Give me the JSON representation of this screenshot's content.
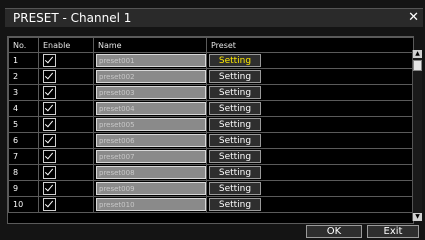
{
  "window": {
    "title": "PRESET - Channel 1",
    "close_glyph": "✕"
  },
  "table": {
    "headers": {
      "no": "No.",
      "enable": "Enable",
      "name": "Name",
      "preset": "Preset"
    },
    "rows": [
      {
        "no": "1",
        "enabled": true,
        "name": "preset001",
        "button": "Setting"
      },
      {
        "no": "2",
        "enabled": true,
        "name": "preset002",
        "button": "Setting"
      },
      {
        "no": "3",
        "enabled": true,
        "name": "preset003",
        "button": "Setting"
      },
      {
        "no": "4",
        "enabled": true,
        "name": "preset004",
        "button": "Setting"
      },
      {
        "no": "5",
        "enabled": true,
        "name": "preset005",
        "button": "Setting"
      },
      {
        "no": "6",
        "enabled": true,
        "name": "preset006",
        "button": "Setting"
      },
      {
        "no": "7",
        "enabled": true,
        "name": "preset007",
        "button": "Setting"
      },
      {
        "no": "8",
        "enabled": true,
        "name": "preset008",
        "button": "Setting"
      },
      {
        "no": "9",
        "enabled": true,
        "name": "preset009",
        "button": "Setting"
      },
      {
        "no": "10",
        "enabled": true,
        "name": "preset010",
        "button": "Setting"
      }
    ]
  },
  "footer": {
    "ok_label": "OK",
    "exit_label": "Exit"
  },
  "colors": {
    "active_button_text": "#ffea00",
    "background": "#141414"
  }
}
